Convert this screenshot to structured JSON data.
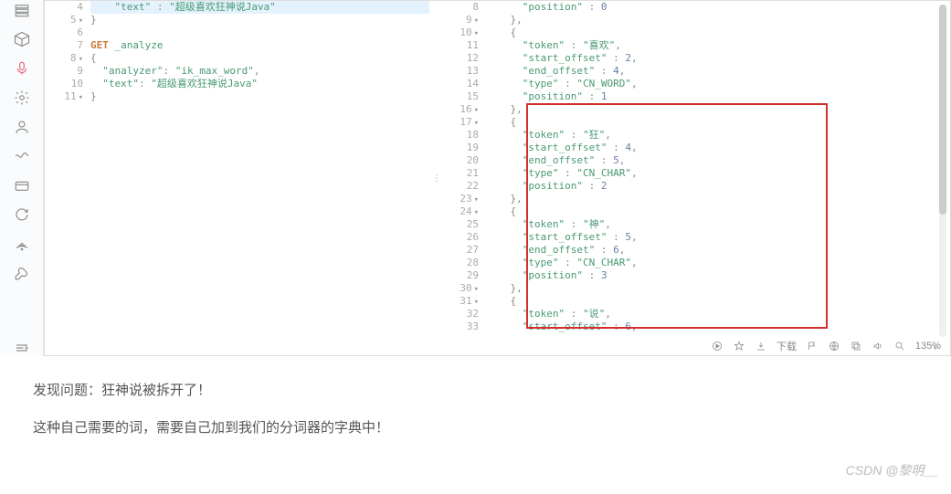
{
  "left": {
    "lines": [
      {
        "n": "4",
        "fold": false,
        "hl": true,
        "tokens": [
          {
            "t": "    ",
            "c": ""
          },
          {
            "t": "\"text\"",
            "c": "tk-key"
          },
          {
            "t": " : ",
            "c": "tk-punct"
          },
          {
            "t": "\"超级喜欢狂神说Java\"",
            "c": "tk-string"
          }
        ]
      },
      {
        "n": "5",
        "fold": true,
        "tokens": [
          {
            "t": "}",
            "c": "tk-punct"
          }
        ]
      },
      {
        "n": "6",
        "fold": false,
        "tokens": []
      },
      {
        "n": "7",
        "fold": false,
        "tokens": [
          {
            "t": "GET ",
            "c": "tk-method"
          },
          {
            "t": "_analyze",
            "c": "tk-endpoint"
          }
        ]
      },
      {
        "n": "8",
        "fold": true,
        "tokens": [
          {
            "t": "{",
            "c": "tk-punct"
          }
        ]
      },
      {
        "n": "9",
        "fold": false,
        "tokens": [
          {
            "t": "  ",
            "c": ""
          },
          {
            "t": "\"analyzer\"",
            "c": "tk-key"
          },
          {
            "t": ": ",
            "c": "tk-punct"
          },
          {
            "t": "\"ik_max_word\"",
            "c": "tk-string"
          },
          {
            "t": ",",
            "c": "tk-punct"
          }
        ]
      },
      {
        "n": "10",
        "fold": false,
        "tokens": [
          {
            "t": "  ",
            "c": ""
          },
          {
            "t": "\"text\"",
            "c": "tk-key"
          },
          {
            "t": ": ",
            "c": "tk-punct"
          },
          {
            "t": "\"超级喜欢狂神说Java\"",
            "c": "tk-string"
          }
        ]
      },
      {
        "n": "11",
        "fold": true,
        "tokens": [
          {
            "t": "}",
            "c": "tk-punct"
          }
        ]
      }
    ]
  },
  "right": {
    "lines": [
      {
        "n": "8",
        "fold": false,
        "tokens": [
          {
            "t": "      ",
            "c": ""
          },
          {
            "t": "\"position\"",
            "c": "tk-key"
          },
          {
            "t": " : ",
            "c": "tk-punct"
          },
          {
            "t": "0",
            "c": "tk-number"
          }
        ]
      },
      {
        "n": "9",
        "fold": true,
        "tokens": [
          {
            "t": "    },",
            "c": "tk-punct"
          }
        ]
      },
      {
        "n": "10",
        "fold": true,
        "tokens": [
          {
            "t": "    {",
            "c": "tk-punct"
          }
        ]
      },
      {
        "n": "11",
        "fold": false,
        "tokens": [
          {
            "t": "      ",
            "c": ""
          },
          {
            "t": "\"token\"",
            "c": "tk-key"
          },
          {
            "t": " : ",
            "c": "tk-punct"
          },
          {
            "t": "\"喜欢\"",
            "c": "tk-string"
          },
          {
            "t": ",",
            "c": "tk-punct"
          }
        ]
      },
      {
        "n": "12",
        "fold": false,
        "tokens": [
          {
            "t": "      ",
            "c": ""
          },
          {
            "t": "\"start_offset\"",
            "c": "tk-key"
          },
          {
            "t": " : ",
            "c": "tk-punct"
          },
          {
            "t": "2",
            "c": "tk-number"
          },
          {
            "t": ",",
            "c": "tk-punct"
          }
        ]
      },
      {
        "n": "13",
        "fold": false,
        "tokens": [
          {
            "t": "      ",
            "c": ""
          },
          {
            "t": "\"end_offset\"",
            "c": "tk-key"
          },
          {
            "t": " : ",
            "c": "tk-punct"
          },
          {
            "t": "4",
            "c": "tk-number"
          },
          {
            "t": ",",
            "c": "tk-punct"
          }
        ]
      },
      {
        "n": "14",
        "fold": false,
        "tokens": [
          {
            "t": "      ",
            "c": ""
          },
          {
            "t": "\"type\"",
            "c": "tk-key"
          },
          {
            "t": " : ",
            "c": "tk-punct"
          },
          {
            "t": "\"CN_WORD\"",
            "c": "tk-string"
          },
          {
            "t": ",",
            "c": "tk-punct"
          }
        ]
      },
      {
        "n": "15",
        "fold": false,
        "tokens": [
          {
            "t": "      ",
            "c": ""
          },
          {
            "t": "\"position\"",
            "c": "tk-key"
          },
          {
            "t": " : ",
            "c": "tk-punct"
          },
          {
            "t": "1",
            "c": "tk-number"
          }
        ]
      },
      {
        "n": "16",
        "fold": true,
        "tokens": [
          {
            "t": "    },",
            "c": "tk-punct"
          }
        ]
      },
      {
        "n": "17",
        "fold": true,
        "tokens": [
          {
            "t": "    {",
            "c": "tk-punct"
          }
        ]
      },
      {
        "n": "18",
        "fold": false,
        "tokens": [
          {
            "t": "      ",
            "c": ""
          },
          {
            "t": "\"token\"",
            "c": "tk-key"
          },
          {
            "t": " : ",
            "c": "tk-punct"
          },
          {
            "t": "\"狂\"",
            "c": "tk-string"
          },
          {
            "t": ",",
            "c": "tk-punct"
          }
        ]
      },
      {
        "n": "19",
        "fold": false,
        "tokens": [
          {
            "t": "      ",
            "c": ""
          },
          {
            "t": "\"start_offset\"",
            "c": "tk-key"
          },
          {
            "t": " : ",
            "c": "tk-punct"
          },
          {
            "t": "4",
            "c": "tk-number"
          },
          {
            "t": ",",
            "c": "tk-punct"
          }
        ]
      },
      {
        "n": "20",
        "fold": false,
        "tokens": [
          {
            "t": "      ",
            "c": ""
          },
          {
            "t": "\"end_offset\"",
            "c": "tk-key"
          },
          {
            "t": " : ",
            "c": "tk-punct"
          },
          {
            "t": "5",
            "c": "tk-number"
          },
          {
            "t": ",",
            "c": "tk-punct"
          }
        ]
      },
      {
        "n": "21",
        "fold": false,
        "tokens": [
          {
            "t": "      ",
            "c": ""
          },
          {
            "t": "\"type\"",
            "c": "tk-key"
          },
          {
            "t": " : ",
            "c": "tk-punct"
          },
          {
            "t": "\"CN_CHAR\"",
            "c": "tk-string"
          },
          {
            "t": ",",
            "c": "tk-punct"
          }
        ]
      },
      {
        "n": "22",
        "fold": false,
        "tokens": [
          {
            "t": "      ",
            "c": ""
          },
          {
            "t": "\"position\"",
            "c": "tk-key"
          },
          {
            "t": " : ",
            "c": "tk-punct"
          },
          {
            "t": "2",
            "c": "tk-number"
          }
        ]
      },
      {
        "n": "23",
        "fold": true,
        "tokens": [
          {
            "t": "    },",
            "c": "tk-punct"
          }
        ]
      },
      {
        "n": "24",
        "fold": true,
        "tokens": [
          {
            "t": "    {",
            "c": "tk-punct"
          }
        ]
      },
      {
        "n": "25",
        "fold": false,
        "tokens": [
          {
            "t": "      ",
            "c": ""
          },
          {
            "t": "\"token\"",
            "c": "tk-key"
          },
          {
            "t": " : ",
            "c": "tk-punct"
          },
          {
            "t": "\"神\"",
            "c": "tk-string"
          },
          {
            "t": ",",
            "c": "tk-punct"
          }
        ]
      },
      {
        "n": "26",
        "fold": false,
        "tokens": [
          {
            "t": "      ",
            "c": ""
          },
          {
            "t": "\"start_offset\"",
            "c": "tk-key"
          },
          {
            "t": " : ",
            "c": "tk-punct"
          },
          {
            "t": "5",
            "c": "tk-number"
          },
          {
            "t": ",",
            "c": "tk-punct"
          }
        ]
      },
      {
        "n": "27",
        "fold": false,
        "tokens": [
          {
            "t": "      ",
            "c": ""
          },
          {
            "t": "\"end_offset\"",
            "c": "tk-key"
          },
          {
            "t": " : ",
            "c": "tk-punct"
          },
          {
            "t": "6",
            "c": "tk-number"
          },
          {
            "t": ",",
            "c": "tk-punct"
          }
        ]
      },
      {
        "n": "28",
        "fold": false,
        "tokens": [
          {
            "t": "      ",
            "c": ""
          },
          {
            "t": "\"type\"",
            "c": "tk-key"
          },
          {
            "t": " : ",
            "c": "tk-punct"
          },
          {
            "t": "\"CN_CHAR\"",
            "c": "tk-string"
          },
          {
            "t": ",",
            "c": "tk-punct"
          }
        ]
      },
      {
        "n": "29",
        "fold": false,
        "tokens": [
          {
            "t": "      ",
            "c": ""
          },
          {
            "t": "\"position\"",
            "c": "tk-key"
          },
          {
            "t": " : ",
            "c": "tk-punct"
          },
          {
            "t": "3",
            "c": "tk-number"
          }
        ]
      },
      {
        "n": "30",
        "fold": true,
        "tokens": [
          {
            "t": "    },",
            "c": "tk-punct"
          }
        ]
      },
      {
        "n": "31",
        "fold": true,
        "tokens": [
          {
            "t": "    {",
            "c": "tk-punct"
          }
        ]
      },
      {
        "n": "32",
        "fold": false,
        "tokens": [
          {
            "t": "      ",
            "c": ""
          },
          {
            "t": "\"token\"",
            "c": "tk-key"
          },
          {
            "t": " : ",
            "c": "tk-punct"
          },
          {
            "t": "\"说\"",
            "c": "tk-string"
          },
          {
            "t": ",",
            "c": "tk-punct"
          }
        ]
      },
      {
        "n": "33",
        "fold": false,
        "tokens": [
          {
            "t": "      ",
            "c": ""
          },
          {
            "t": "\"start_offset\"",
            "c": "tk-key"
          },
          {
            "t": " : ",
            "c": "tk-punct"
          },
          {
            "t": "6",
            "c": "tk-number"
          },
          {
            "t": ",",
            "c": "tk-punct"
          }
        ]
      }
    ]
  },
  "toolbar": {
    "download_label": "下载",
    "zoom": "135%"
  },
  "commentary": {
    "p1": "发现问题：狂神说被拆开了！",
    "p2": "这种自己需要的词，需要自己加到我们的分词器的字典中！"
  },
  "watermark": "CSDN @黎明__"
}
